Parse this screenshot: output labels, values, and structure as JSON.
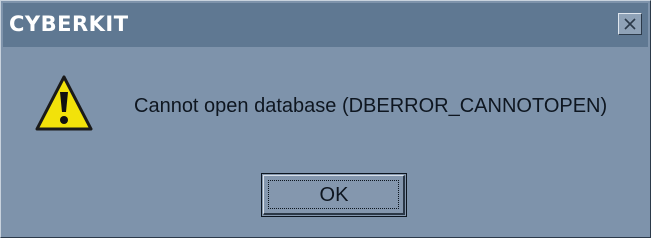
{
  "window": {
    "title": "CYBERKIT"
  },
  "icons": {
    "alert": "warning-icon",
    "close": "close-icon"
  },
  "message": {
    "text": "Cannot open database (DBERROR_CANNOTOPEN)"
  },
  "buttons": {
    "ok_label": "OK"
  },
  "colors": {
    "dialog_bg": "#7e93ab",
    "titlebar_bg": "#5f7892",
    "warning_yellow": "#f2e20a"
  }
}
